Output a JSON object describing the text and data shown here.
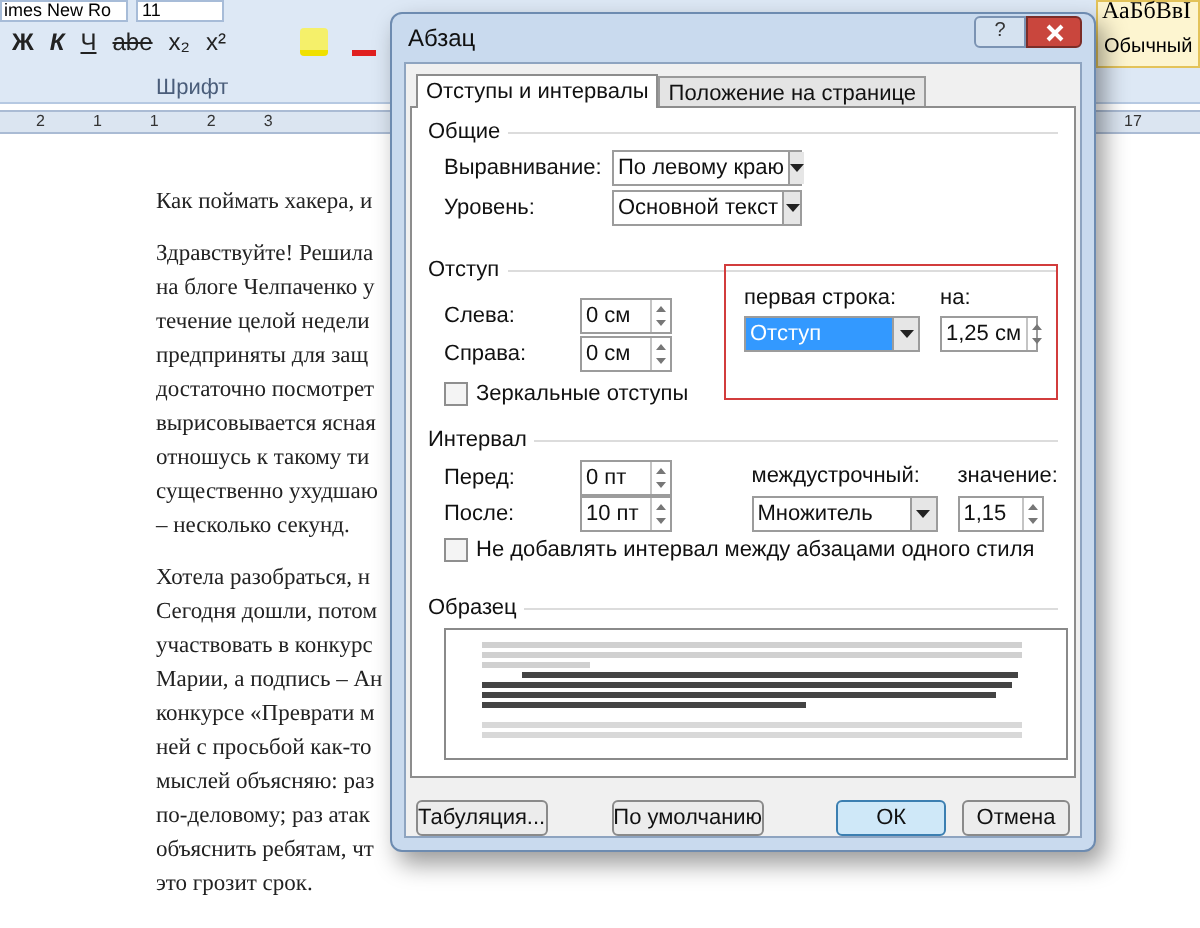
{
  "ribbon": {
    "font_name": "imes New Ro",
    "font_size": "11",
    "format_buttons": [
      "Ж",
      "К",
      "Ч",
      "abe",
      "x₂",
      "x²"
    ],
    "group_label": "Шрифт",
    "style_sample": "АаБбВвІ",
    "style_name": "Обычный"
  },
  "ruler": {
    "left_marks": [
      "2",
      "1",
      "1",
      "2",
      "3"
    ],
    "right_mark": "17"
  },
  "document": {
    "paragraphs": [
      {
        "lines": [
          "Как поймать хакера, и"
        ]
      },
      {
        "lines": [
          "Здравствуйте! Решила",
          "на блоге Челпаченко у",
          "течение целой недели",
          "предприняты для защ",
          "достаточно посмотрет",
          "вырисовывается ясная",
          "отношусь к такому ти",
          "существенно ухудшаю",
          "– несколько секунд."
        ]
      },
      {
        "lines": [
          "Хотела разобраться, н",
          "Сегодня дошли, потом",
          "участвовать в конкурс",
          "Марии, а подпись – Ан",
          "конкурсе «Преврати м",
          "ней с просьбой как-то",
          "мыслей объясняю: раз",
          "по-деловому; раз атак",
          "объяснить ребятам, чт",
          "это грозит срок."
        ]
      }
    ]
  },
  "dialog": {
    "title": "Абзац",
    "help": "?",
    "tabs": [
      {
        "label": "Отступы и интервалы",
        "selected": true
      },
      {
        "label": "Положение на странице",
        "selected": false
      }
    ],
    "general": {
      "heading": "Общие",
      "fields": [
        {
          "label": "Выравнивание:",
          "value": "По левому краю"
        },
        {
          "label": "Уровень:",
          "value": "Основной текст"
        }
      ]
    },
    "indent": {
      "heading": "Отступ",
      "left": {
        "label": "Слева:",
        "value": "0 см"
      },
      "right": {
        "label": "Справа:",
        "value": "0 см"
      },
      "mirror": {
        "label": "Зеркальные отступы",
        "checked": false
      },
      "first_line": {
        "label": "первая строка:",
        "value": "Отступ",
        "selected": true
      },
      "by": {
        "label": "на:",
        "value": "1,25 см"
      }
    },
    "spacing": {
      "heading": "Интервал",
      "before": {
        "label": "Перед:",
        "value": "0 пт"
      },
      "after": {
        "label": "После:",
        "value": "10 пт"
      },
      "line": {
        "label": "междустрочный:",
        "value": "Множитель",
        "selected": false
      },
      "at": {
        "label": "значение:",
        "value": "1,15"
      },
      "no_space": {
        "label": "Не добавлять интервал между абзацами одного стиля",
        "checked": false
      }
    },
    "preview": {
      "heading": "Образец"
    },
    "buttons": [
      {
        "label": "Табуляция...",
        "default": false
      },
      {
        "label": "По умолчанию",
        "default": false
      },
      {
        "label": "ОК",
        "default": true
      },
      {
        "label": "Отмена",
        "default": false
      }
    ]
  }
}
